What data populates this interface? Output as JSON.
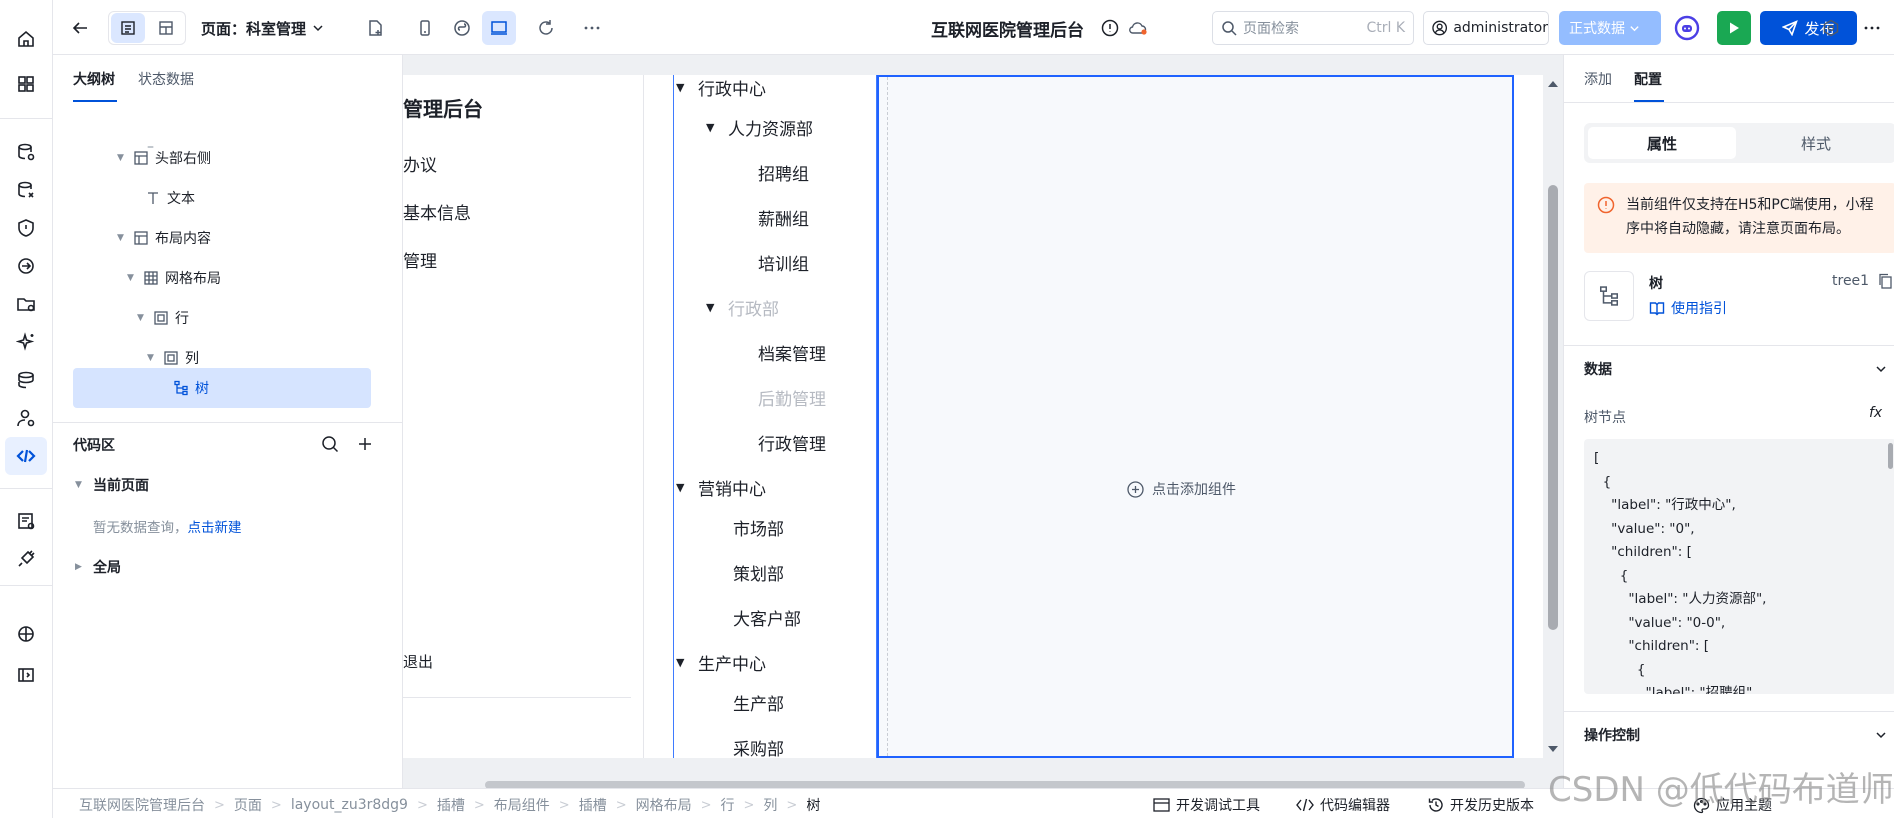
{
  "topbar": {
    "page_label": "页面：科室管理",
    "app_title": "互联网医院管理后台",
    "search_placeholder": "页面检索",
    "search_hint": "Ctrl K",
    "user": "administrator",
    "env": "正式数据",
    "publish": "发布"
  },
  "outline": {
    "tab_tree": "大纲树",
    "tab_state": "状态数据",
    "nodes": {
      "n0": "–",
      "n1": "头部右侧",
      "n2": "文本",
      "n3": "布局内容",
      "n4": "网格布局",
      "n5": "行",
      "n6": "列",
      "n7": "树"
    },
    "code": {
      "title": "代码区",
      "current_page": "当前页面",
      "empty": "暂无数据查询，",
      "create": "点击新建",
      "global": "全局"
    }
  },
  "canvas": {
    "menu": [
      "管理后台",
      "办议",
      "基本信息",
      "管理",
      "退出"
    ],
    "tree": {
      "t0": "行政中心",
      "t1": "人力资源部",
      "t2": "招聘组",
      "t3": "薪酬组",
      "t4": "培训组",
      "t5": "行政部",
      "t6": "档案管理",
      "t7": "后勤管理",
      "t8": "行政管理",
      "t9": "营销中心",
      "t10": "市场部",
      "t11": "策划部",
      "t12": "大客户部",
      "t13": "生产中心",
      "t14": "生产部",
      "t15": "采购部"
    },
    "add_component": "点击添加组件"
  },
  "config": {
    "tab_add": "添加",
    "tab_config": "配置",
    "seg_props": "属性",
    "seg_style": "样式",
    "warning": "当前组件仅支持在H5和PC端使用，小程序中将自动隐藏，请注意页面布局。",
    "component_name": "树",
    "component_id": "tree1",
    "guide": "使用指引",
    "section_data": "数据",
    "field_label": "树节点",
    "fx": "fx",
    "json": "[\n  {\n    \"label\": \"行政中心\",\n    \"value\": \"0\",\n    \"children\": [\n      {\n        \"label\": \"人力资源部\",\n        \"value\": \"0-0\",\n        \"children\": [\n          {\n            \"label\": \"招聘组\",",
    "section_ops": "操作控制",
    "apply_theme": "应用主题"
  },
  "footer": {
    "crumbs": [
      "互联网医院管理后台",
      "页面",
      "layout_zu3r8dg9",
      "插槽",
      "布局组件",
      "插槽",
      "网格布局",
      "行",
      "列",
      "树"
    ],
    "debug": "开发调试工具",
    "code_editor": "代码编辑器",
    "history": "开发历史版本"
  },
  "watermark": "CSDN @低代码布道师",
  "colors": {
    "primary": "#0052d9",
    "run": "#1aa853",
    "env": "#94bdff",
    "warning_bg": "#fff1e8",
    "selection": "#d6e4ff"
  }
}
